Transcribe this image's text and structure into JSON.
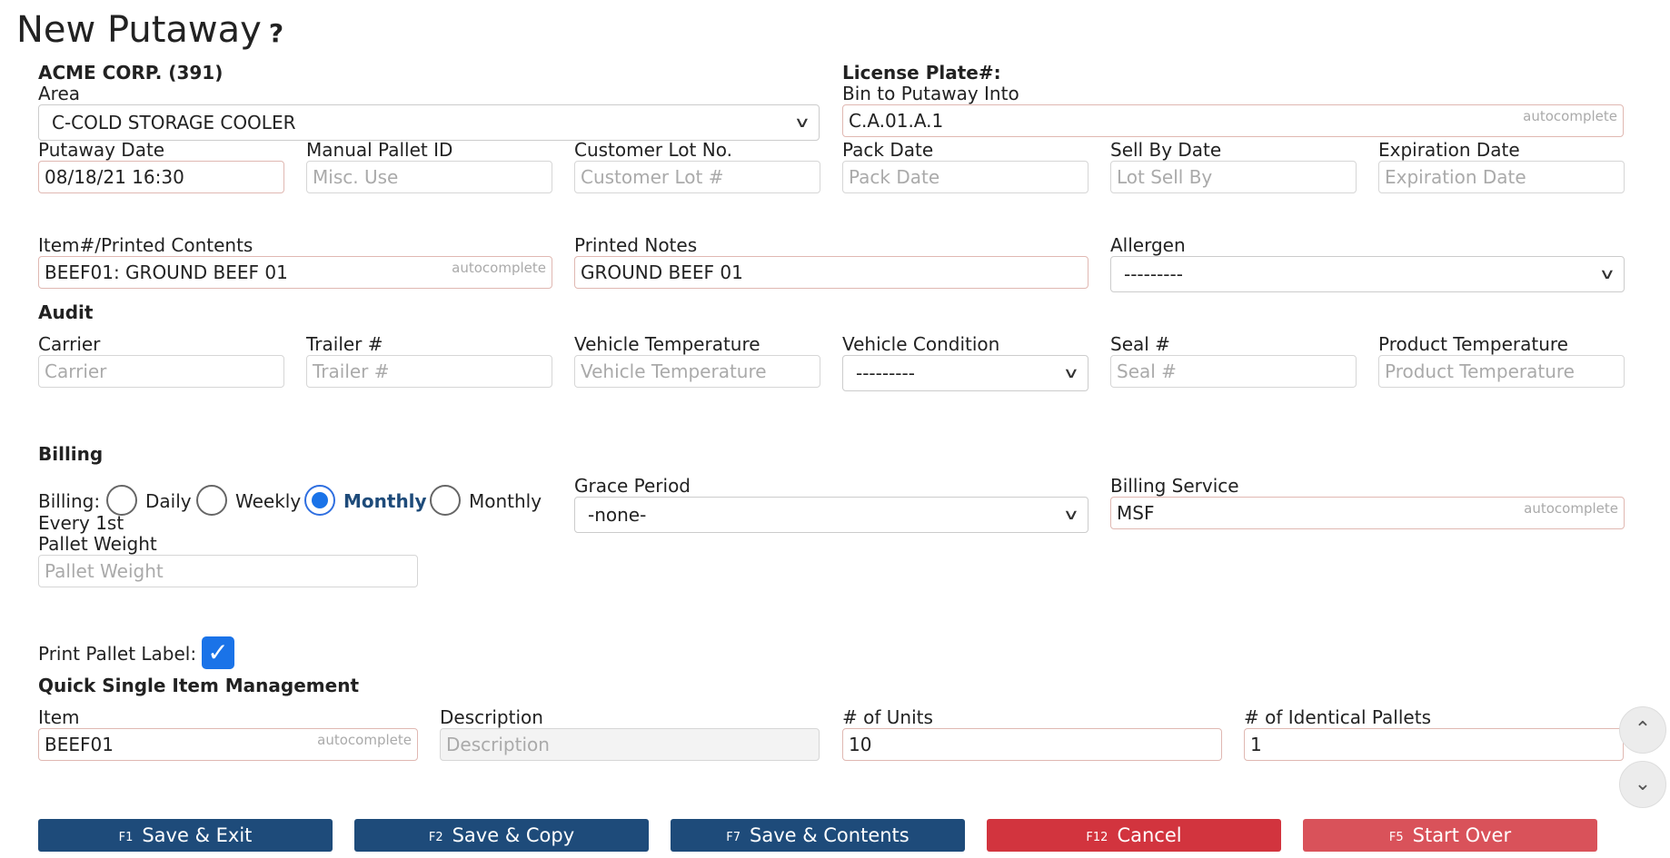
{
  "page": {
    "title": "New Putaway",
    "help": "?"
  },
  "header": {
    "company": "ACME CORP. (391)",
    "license_plate_label": "License Plate#:"
  },
  "area": {
    "label": "Area",
    "value": "C-COLD STORAGE COOLER"
  },
  "bin": {
    "label": "Bin to Putaway Into",
    "value": "C.A.01.A.1",
    "hint": "autocomplete"
  },
  "putaway_date": {
    "label": "Putaway Date",
    "value": "08/18/21 16:30"
  },
  "manual_pallet_id": {
    "label": "Manual Pallet ID",
    "placeholder": "Misc. Use"
  },
  "customer_lot": {
    "label": "Customer Lot No.",
    "placeholder": "Customer Lot #"
  },
  "pack_date": {
    "label": "Pack Date",
    "placeholder": "Pack Date"
  },
  "sell_by_date": {
    "label": "Sell By Date",
    "placeholder": "Lot Sell By"
  },
  "expiration_date": {
    "label": "Expiration Date",
    "placeholder": "Expiration Date"
  },
  "item_contents": {
    "label": "Item#/Printed Contents",
    "value": "BEEF01: GROUND BEEF 01",
    "hint": "autocomplete"
  },
  "printed_notes": {
    "label": "Printed Notes",
    "value": "GROUND BEEF 01"
  },
  "allergen": {
    "label": "Allergen",
    "value": "---------"
  },
  "audit": {
    "heading": "Audit",
    "carrier": {
      "label": "Carrier",
      "placeholder": "Carrier"
    },
    "trailer": {
      "label": "Trailer #",
      "placeholder": "Trailer #"
    },
    "vehicle_temp": {
      "label": "Vehicle Temperature",
      "placeholder": "Vehicle Temperature"
    },
    "vehicle_condition": {
      "label": "Vehicle Condition",
      "value": "---------"
    },
    "seal": {
      "label": "Seal #",
      "placeholder": "Seal #"
    },
    "product_temp": {
      "label": "Product Temperature",
      "placeholder": "Product Temperature"
    }
  },
  "billing": {
    "heading": "Billing",
    "label": "Billing:",
    "options": [
      "Daily",
      "Weekly",
      "Monthly",
      "Monthly"
    ],
    "selected": "Monthly",
    "wrap_text": "Every 1st",
    "grace_period": {
      "label": "Grace Period",
      "value": "-none-"
    },
    "billing_service": {
      "label": "Billing Service",
      "value": "MSF",
      "hint": "autocomplete"
    },
    "pallet_weight": {
      "label": "Pallet Weight",
      "placeholder": "Pallet Weight"
    }
  },
  "print_label": {
    "label": "Print Pallet Label:",
    "checked": true
  },
  "quick_item": {
    "heading": "Quick Single Item Management",
    "item": {
      "label": "Item",
      "value": "BEEF01",
      "hint": "autocomplete"
    },
    "description": {
      "label": "Description",
      "placeholder": "Description"
    },
    "units": {
      "label": "# of Units",
      "value": "10"
    },
    "pallets": {
      "label": "# of Identical Pallets",
      "value": "1"
    }
  },
  "buttons": [
    {
      "key": "F1",
      "label": "Save & Exit"
    },
    {
      "key": "F2",
      "label": "Save & Copy"
    },
    {
      "key": "F7",
      "label": "Save & Contents"
    },
    {
      "key": "F12",
      "label": "Cancel"
    },
    {
      "key": "F5",
      "label": "Start Over"
    }
  ],
  "scroll": {
    "up": "⌃",
    "down": "⌄"
  },
  "colors": {
    "primary": "#1e4b7a",
    "danger": "#d2343e",
    "accent": "#1a73e8"
  }
}
